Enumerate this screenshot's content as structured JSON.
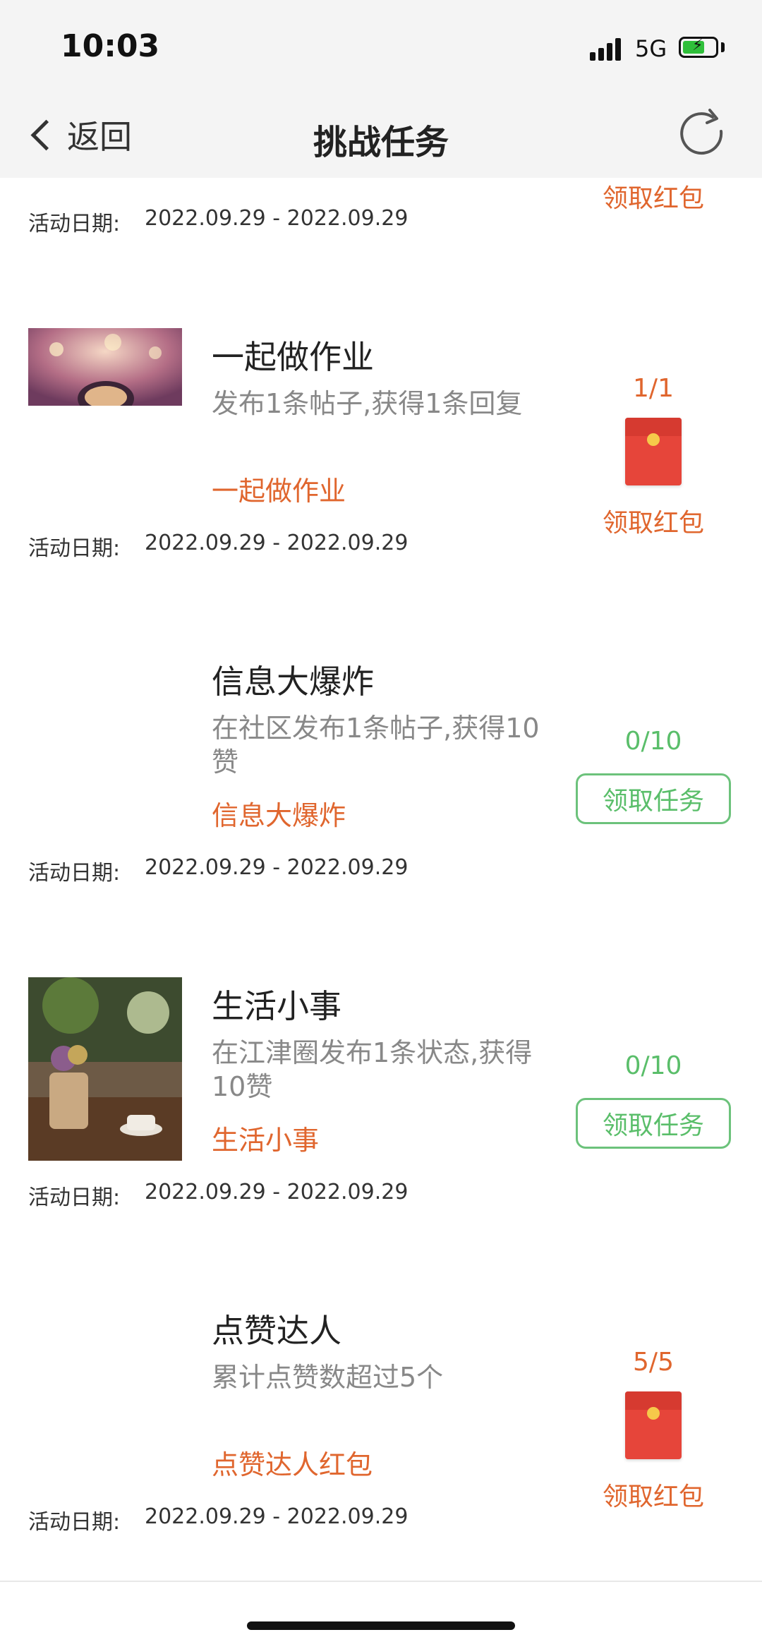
{
  "status": {
    "time": "10:03",
    "network": "5G"
  },
  "header": {
    "back_label": "返回",
    "title": "挑战任务"
  },
  "date_label": "活动日期:",
  "tasks": [
    {
      "title": "",
      "desc": "",
      "tag": "",
      "date": "2022.09.29 - 2022.09.29",
      "progress": "",
      "action": "领取红包"
    },
    {
      "title": "一起做作业",
      "desc": "发布1条帖子,获得1条回复",
      "tag": "一起做作业",
      "date": "2022.09.29 - 2022.09.29",
      "progress": "1/1",
      "action": "领取红包"
    },
    {
      "title": "信息大爆炸",
      "desc": "在社区发布1条帖子,获得10赞",
      "tag": "信息大爆炸",
      "date": "2022.09.29 - 2022.09.29",
      "progress": "0/10",
      "action": "领取任务"
    },
    {
      "title": "生活小事",
      "desc": "在江津圈发布1条状态,获得10赞",
      "tag": "生活小事",
      "date": "2022.09.29 - 2022.09.29",
      "progress": "0/10",
      "action": "领取任务"
    },
    {
      "title": "点赞达人",
      "desc": "累计点赞数超过5个",
      "tag": "点赞达人红包",
      "date": "2022.09.29 - 2022.09.29",
      "progress": "5/5",
      "action": "领取红包"
    }
  ],
  "colors": {
    "accent_orange": "#e0662e",
    "accent_green": "#5abe6a",
    "red_packet": "#e6453a"
  }
}
